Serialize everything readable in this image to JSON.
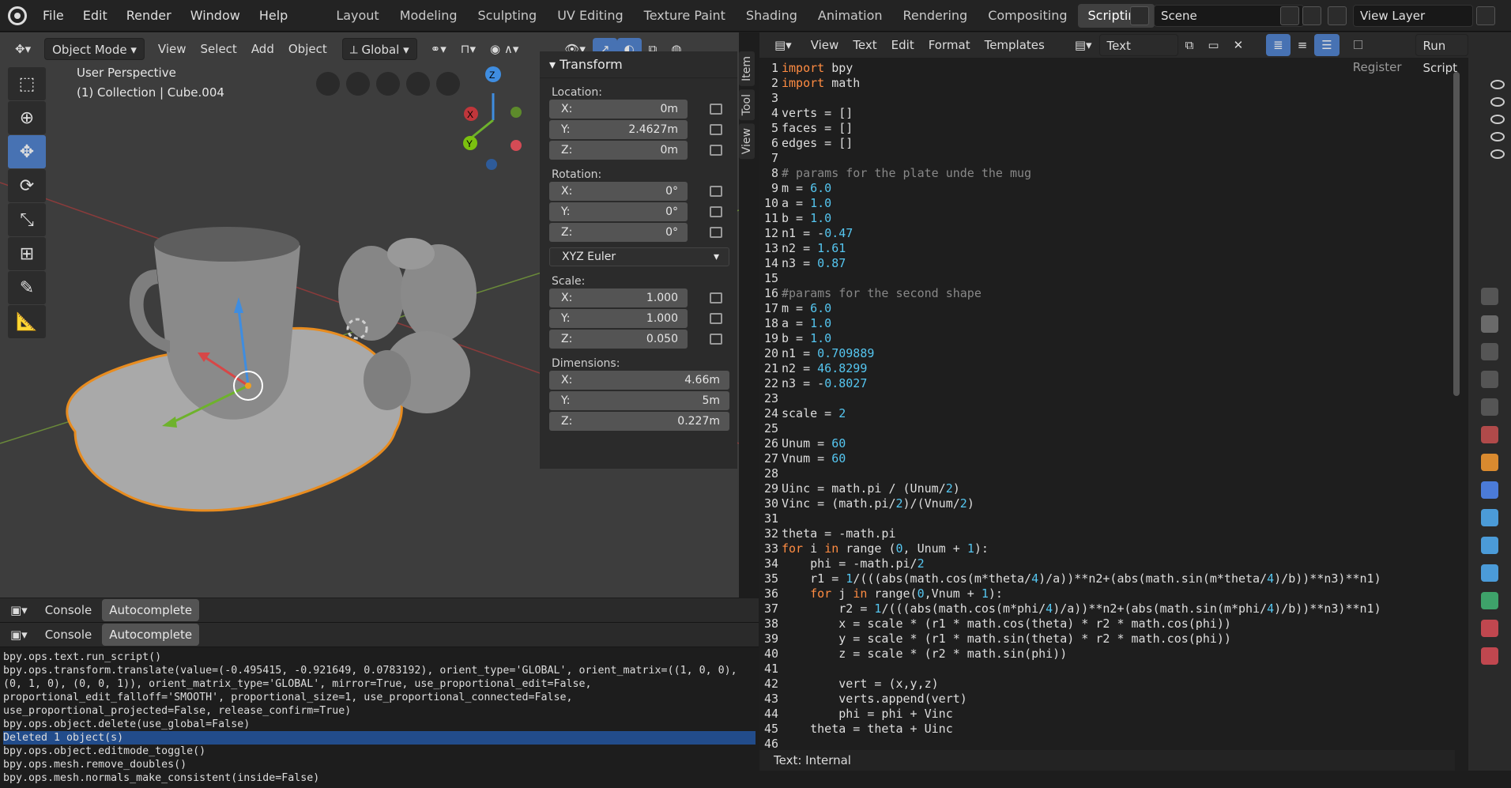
{
  "menu": [
    "File",
    "Edit",
    "Render",
    "Window",
    "Help"
  ],
  "workspaces": [
    "Layout",
    "Modeling",
    "Sculpting",
    "UV Editing",
    "Texture Paint",
    "Shading",
    "Animation",
    "Rendering",
    "Compositing",
    "Scripting"
  ],
  "active_workspace": "Scripting",
  "scene": "Scene",
  "view_layer": "View Layer",
  "viewport": {
    "mode": "Object Mode",
    "menus": [
      "View",
      "Select",
      "Add",
      "Object"
    ],
    "orientation": "Global",
    "view_name": "User Perspective",
    "collection": "(1) Collection | Cube.004"
  },
  "transform": {
    "title": "Transform",
    "location_label": "Location:",
    "location": [
      {
        "k": "X:",
        "v": "0m"
      },
      {
        "k": "Y:",
        "v": "2.4627m"
      },
      {
        "k": "Z:",
        "v": "0m"
      }
    ],
    "rotation_label": "Rotation:",
    "rotation": [
      {
        "k": "X:",
        "v": "0°"
      },
      {
        "k": "Y:",
        "v": "0°"
      },
      {
        "k": "Z:",
        "v": "0°"
      }
    ],
    "rotation_mode": "XYZ Euler",
    "scale_label": "Scale:",
    "scale": [
      {
        "k": "X:",
        "v": "1.000"
      },
      {
        "k": "Y:",
        "v": "1.000"
      },
      {
        "k": "Z:",
        "v": "0.050"
      }
    ],
    "dimensions_label": "Dimensions:",
    "dimensions": [
      {
        "k": "X:",
        "v": "4.66m"
      },
      {
        "k": "Y:",
        "v": "5m"
      },
      {
        "k": "Z:",
        "v": "0.227m"
      }
    ]
  },
  "side_tabs": [
    "Item",
    "Tool",
    "View"
  ],
  "console": {
    "tab1": "Console",
    "tab2": "Autocomplete",
    "lines": [
      "bpy.ops.text.run_script()",
      "bpy.ops.transform.translate(value=(-0.495415, -0.921649, 0.0783192), orient_type='GLOBAL', orient_matrix=((1, 0, 0), (0, 1, 0), (0, 0, 1)), orient_matrix_type='GLOBAL', mirror=True, use_proportional_edit=False, proportional_edit_falloff='SMOOTH', proportional_size=1, use_proportional_connected=False, use_proportional_projected=False, release_confirm=True)",
      "bpy.ops.object.delete(use_global=False)",
      "Deleted 1 object(s)",
      "bpy.ops.object.editmode_toggle()",
      "bpy.ops.mesh.remove_doubles()",
      "bpy.ops.mesh.normals_make_consistent(inside=False)"
    ]
  },
  "editor": {
    "menus": [
      "View",
      "Text",
      "Edit",
      "Format",
      "Templates"
    ],
    "text_name": "Text",
    "register": "Register",
    "run": "Run Script",
    "status": "Text: Internal",
    "code": [
      "import bpy",
      "import math",
      "",
      "verts = []",
      "faces = []",
      "edges = []",
      "",
      "# params for the plate unde the mug",
      "m = 6.0",
      "a = 1.0",
      "b = 1.0",
      "n1 = -0.47",
      "n2 = 1.61",
      "n3 = 0.87",
      "",
      "#params for the second shape",
      "m = 6.0",
      "a = 1.0",
      "b = 1.0",
      "n1 = 0.709889",
      "n2 = 46.8299",
      "n3 = -0.8027",
      "",
      "scale = 2",
      "",
      "Unum = 60",
      "Vnum = 60",
      "",
      "Uinc = math.pi / (Unum/2)",
      "Vinc = (math.pi/2)/(Vnum/2)",
      "",
      "theta = -math.pi",
      "for i in range (0, Unum + 1):",
      "    phi = -math.pi/2",
      "    r1 = 1/(((abs(math.cos(m*theta/4)/a))**n2+(abs(math.sin(m*theta/4)/b))**n3)**n1)",
      "    for j in range(0,Vnum + 1):",
      "        r2 = 1/(((abs(math.cos(m*phi/4)/a))**n2+(abs(math.sin(m*phi/4)/b))**n3)**n1)",
      "        x = scale * (r1 * math.cos(theta) * r2 * math.cos(phi))",
      "        y = scale * (r1 * math.sin(theta) * r2 * math.cos(phi))",
      "        z = scale * (r2 * math.sin(phi))",
      "",
      "        vert = (x,y,z)",
      "        verts.append(vert)",
      "        phi = phi + Vinc",
      "    theta = theta + Uinc",
      ""
    ]
  }
}
